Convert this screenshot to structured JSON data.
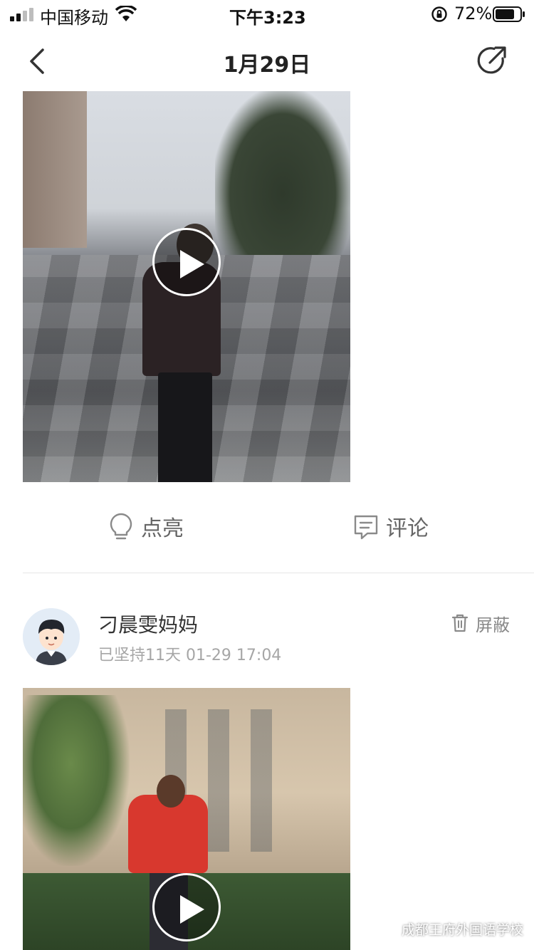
{
  "status_bar": {
    "carrier": "中国移动",
    "time": "下午3:23",
    "battery_percent": "72%",
    "icons": [
      "signal-icon",
      "wifi-icon",
      "rotation-lock-icon",
      "battery-icon"
    ]
  },
  "nav": {
    "title": "1月29日",
    "icons": [
      "back-icon",
      "share-icon"
    ]
  },
  "post1": {
    "media": "video",
    "actions": {
      "like_label": "点亮",
      "comment_label": "评论"
    }
  },
  "post2": {
    "username": "刁晨雯妈妈",
    "meta": "已坚持11天  01-29 17:04",
    "block_label": "屏蔽",
    "media": "video"
  },
  "watermark": {
    "text": "成都王府外国语学校"
  },
  "colors": {
    "accent_text": "#222222",
    "secondary_text": "#666666",
    "muted_text": "#a6a6a6",
    "divider": "#e5e5e5"
  }
}
